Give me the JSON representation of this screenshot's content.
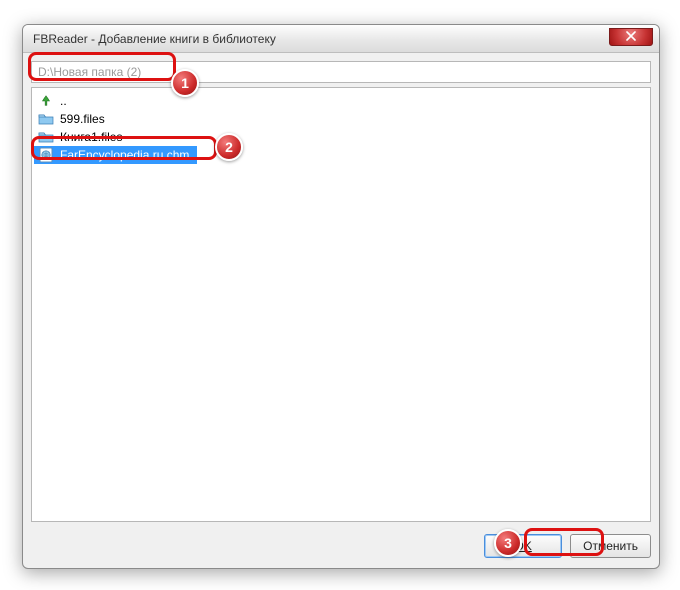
{
  "titlebar": {
    "title": "FBReader - Добавление книги в библиотеку",
    "close_name": "close"
  },
  "path": {
    "value": "D:\\Новая папка (2)"
  },
  "files": {
    "items": [
      {
        "icon": "up-arrow-icon",
        "label": "..",
        "type": "up",
        "selected": false
      },
      {
        "icon": "folder-icon",
        "label": "599.files",
        "type": "folder",
        "selected": false
      },
      {
        "icon": "folder-icon",
        "label": "Книга1.files",
        "type": "folder",
        "selected": false
      },
      {
        "icon": "chm-file-icon",
        "label": "FarEncyclopedia.ru.chm",
        "type": "file",
        "selected": true
      }
    ]
  },
  "buttons": {
    "ok": "OK",
    "cancel": "Отменить"
  },
  "annotations": {
    "a1": "1",
    "a2": "2",
    "a3": "3"
  }
}
